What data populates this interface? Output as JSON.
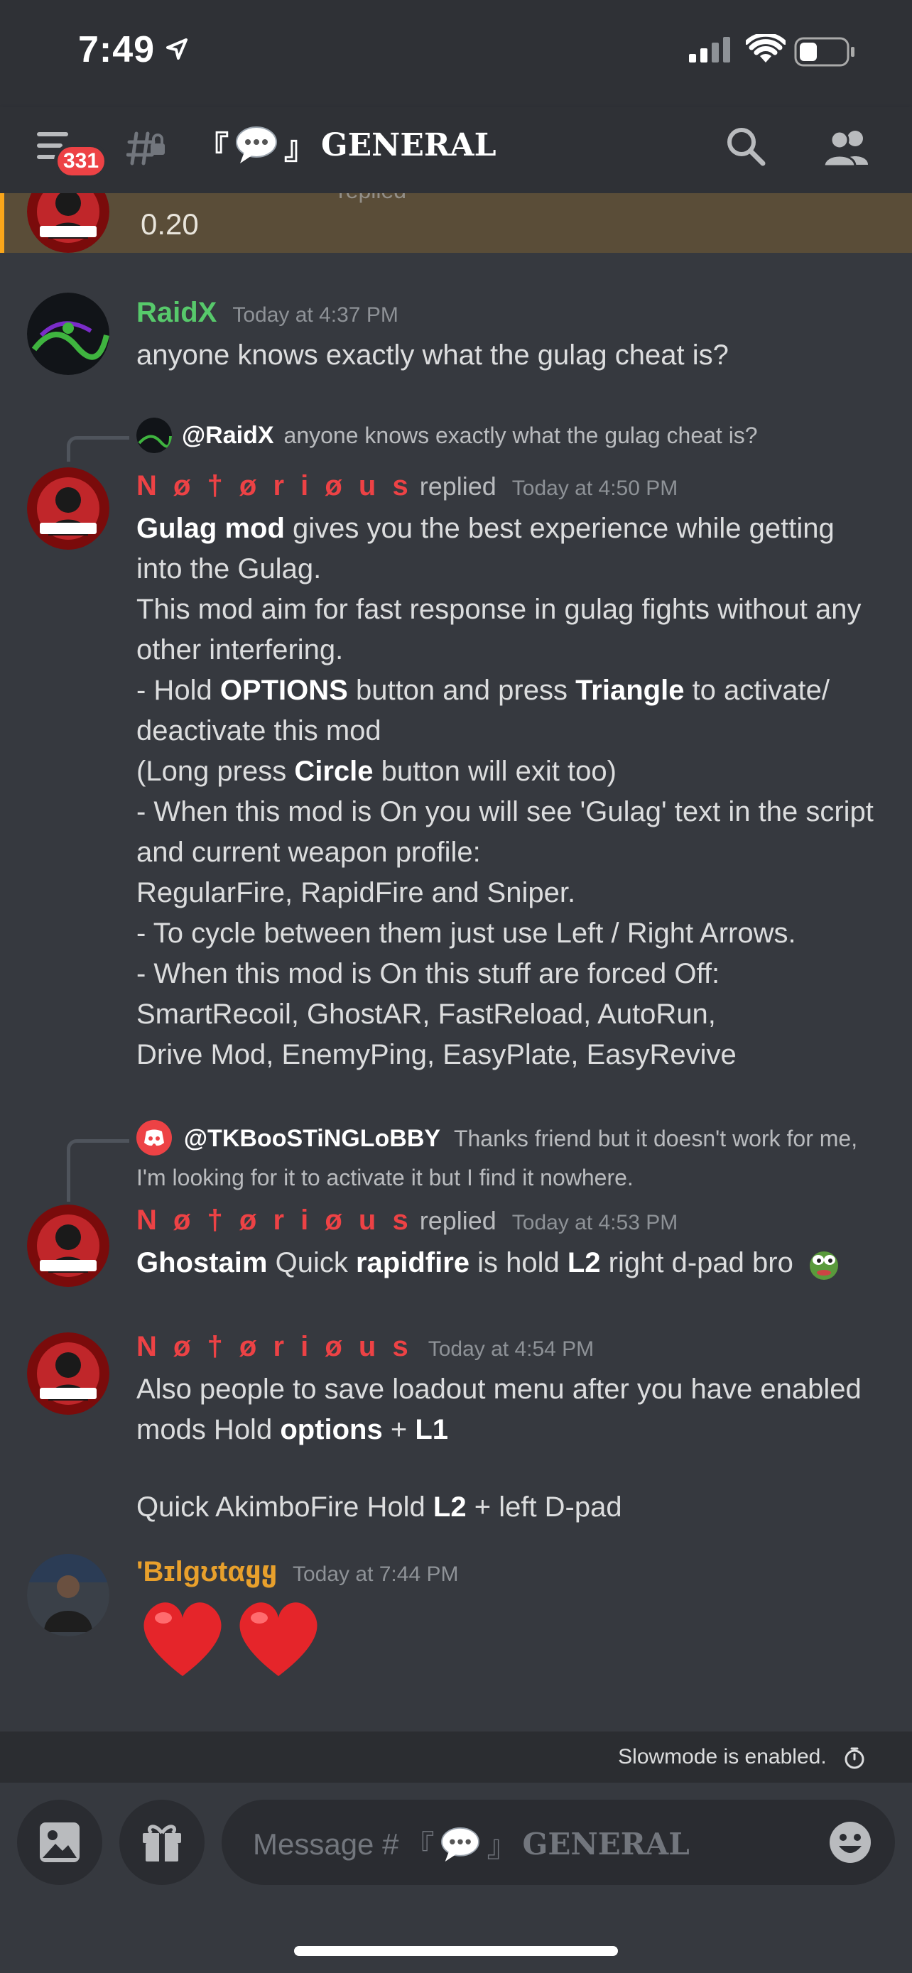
{
  "status": {
    "time": "7:49"
  },
  "header": {
    "badge": "331",
    "channel_name": "GENERAL",
    "bracket_open": "『",
    "bracket_close": "』"
  },
  "highlight": {
    "text": "0.20",
    "replied": "replied"
  },
  "messages": [
    {
      "author": "RaidX",
      "author_color": "#57c96b",
      "time": "Today at 4:37 PM",
      "text": "anyone knows exactly what the gulag cheat is?"
    },
    {
      "reply_to": "@RaidX",
      "reply_snippet": "anyone knows exactly what the gulag cheat is?",
      "author": "N ø † ø r i ø u s",
      "replied": "replied",
      "time": "Today at 4:50 PM",
      "lines": {
        "l1a": "Gulag mod",
        "l1b": " gives you the best experience while getting into the Gulag.",
        "l2": "This mod aim for fast response in gulag fights without any other interfering.",
        "l3a": "- Hold ",
        "l3b": "OPTIONS",
        "l3c": " button and press ",
        "l3d": "Triangle",
        "l3e": " to activate/ deactivate this mod",
        "l4a": "(Long press ",
        "l4b": "Circle",
        "l4c": " button will exit too)",
        "l5": "- When this mod is On you will see 'Gulag' text in the script and current weapon profile:",
        "l6": "RegularFire, RapidFire and Sniper.",
        "l7": "- To cycle between them just use Left / Right Arrows.",
        "l8": "- When this mod is On this stuff are forced Off:",
        "l9": "SmartRecoil, GhostAR, FastReload, AutoRun,",
        "l10": "Drive Mod, EnemyPing, EasyPlate, EasyRevive"
      }
    },
    {
      "reply_to": "@TKBooSTiNGLoBBY",
      "reply_snippet": "Thanks friend but it doesn't work for me, I'm looking for it to activate it but I find it nowhere.",
      "author": "N ø † ø r i ø u s",
      "replied": "replied",
      "time": "Today at 4:53 PM",
      "parts": {
        "a": "Ghostaim",
        "b": " Quick ",
        "c": "rapidfire",
        "d": " is hold ",
        "e": "L2",
        "f": " right d-pad bro"
      }
    },
    {
      "author": "N ø † ø r i ø u s",
      "time": "Today at 4:54 PM",
      "parts": {
        "a": "Also people to save loadout menu after you have enabled mods Hold ",
        "b": "options",
        "c": " + ",
        "d": "L1"
      },
      "parts2": {
        "a": "Quick AkimboFire Hold ",
        "b": "L2",
        "c": " + left D-pad"
      }
    },
    {
      "author": "'Bɪlgʊtαყყ",
      "author_color": "#e8a02c",
      "time": "Today at 7:44 PM",
      "emoji": "❤️❤️"
    }
  ],
  "slowmode": "Slowmode is enabled.",
  "input": {
    "placeholder_prefix": "Message #",
    "channel": "GENERAL"
  },
  "colors": {
    "accent_red": "#ed4245",
    "bg": "#36393f",
    "header": "#2f3136",
    "highlight": "#5a4d38"
  }
}
